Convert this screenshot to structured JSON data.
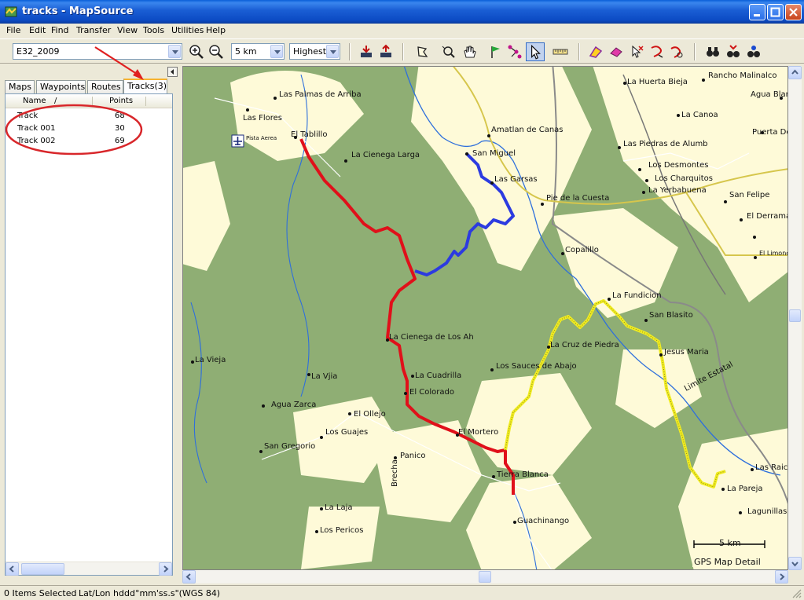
{
  "window": {
    "title": "tracks - MapSource"
  },
  "menu": [
    "File",
    "Edit",
    "Find",
    "Transfer",
    "View",
    "Tools",
    "Utilities",
    "Help"
  ],
  "toolbar": {
    "map_product": "E32_2009",
    "zoom_scale": "5 km",
    "detail_level": "Highest"
  },
  "tabs": [
    "Maps",
    "Waypoints",
    "Routes",
    "Tracks(3)"
  ],
  "tracks_list": {
    "columns": {
      "name": "Name",
      "sort_marker": "/",
      "points": "Points"
    },
    "rows": [
      {
        "name": "Track",
        "points": "68"
      },
      {
        "name": "Track 001",
        "points": "30"
      },
      {
        "name": "Track 002",
        "points": "69"
      }
    ]
  },
  "map": {
    "scale_label": "5 km",
    "detail_label": "GPS Map Detail",
    "track_colors": {
      "track": "#e0101a",
      "track_001": "#2c3be0",
      "track_002": "#f0ec20"
    },
    "labels": {
      "las_palmas": "Las Palmas de Arriba",
      "las_flores": "Las Flores",
      "pista_aerea": "Pista Aerea",
      "el_tablillo": "El Tablillo",
      "la_cienega_larga": "La Cienega Larga",
      "amatlan": "Amatlan de Canas",
      "san_miguel": "San Miguel",
      "las_garsas": "Las Garsas",
      "pie_de_la_cuesta": "Pie de la Cuesta",
      "la_huerta_bieja": "La Huerta Bieja",
      "rancho_malinalco": "Rancho Malinalco",
      "agua_blanca": "Agua Blan",
      "la_canoa": "La Canoa",
      "puerta_del": "Puerta Del C",
      "las_piedras": "Las Piedras de Alumb",
      "los_desmontes": "Los Desmontes",
      "los_charquitos": "Los Charquitos",
      "la_yerbabuena": "La Yerbabuena",
      "san_felipe": "San Felipe",
      "el_derrama": "El Derrama",
      "el_limoncito": "El Limoncit",
      "copalillo": "Copalillo",
      "la_fundicion": "La Fundicion",
      "san_blasito": "San Blasito",
      "la_cruz_de_piedra": "La Cruz de Piedra",
      "jesus_maria": "Jesus Maria",
      "limite_estatal": "Limite Estatal",
      "la_cienega_de_los": "La Cienega de Los Ah",
      "la_vieja": "La Vieja",
      "la_vjia": "La Vjia",
      "la_cuadrilla": "La Cuadrilla",
      "los_sauces": "Los Sauces de Abajo",
      "el_colorado": "El Colorado",
      "agua_zarca": "Agua Zarca",
      "el_ollejo": "El Ollejo",
      "los_guajes": "Los Guajes",
      "san_gregorio": "San Gregorio",
      "el_mortero": "El Mortero",
      "panico": "Panico",
      "brecha": "Brecha",
      "tierra_blanca": "Tierra Blanca",
      "las_raices": "Las Raic",
      "la_pareja": "La Pareja",
      "lagunillas": "Lagunillas",
      "la_laja": "La Laja",
      "los_pericos": "Los Pericos",
      "guachinango": "Guachinango"
    }
  },
  "status": {
    "selection": "0 Items Selected",
    "coord_format": "Lat/Lon hddd°mm'ss.s\"(WGS 84)"
  }
}
